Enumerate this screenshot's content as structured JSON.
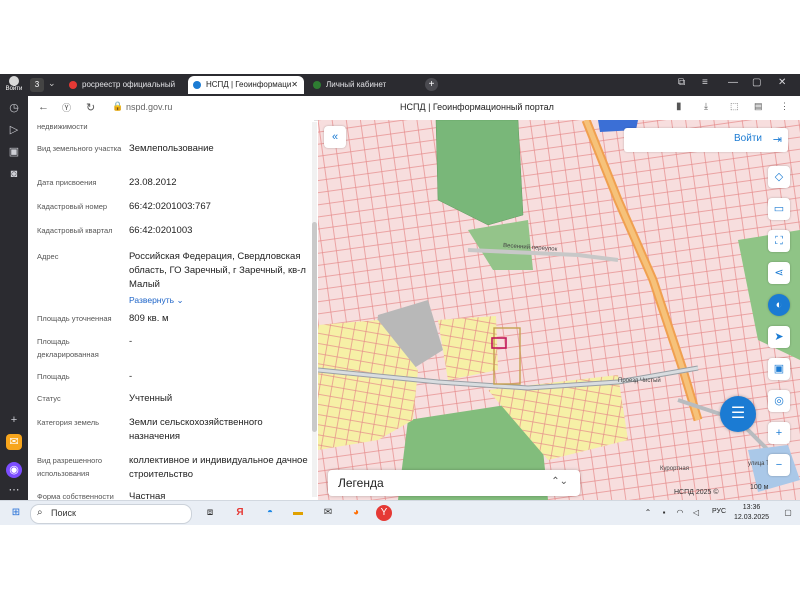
{
  "browser": {
    "tabs": [
      {
        "title": "росреестр официальный",
        "fav_color": "#e53935"
      },
      {
        "title": "НСПД | Геоинформаци",
        "fav_color": "#1b7bd3"
      },
      {
        "title": "Личный кабинет",
        "fav_color": "#2e7d32"
      }
    ],
    "url": "nspd.gov.ru",
    "page_title": "НСПД | Геоинформационный портал",
    "rail_login": "Войти"
  },
  "panel": {
    "top_fragment": "недвижимости",
    "fields": [
      {
        "label": "Вид земельного участка",
        "value": "Землепользование"
      },
      {
        "label": "Дата присвоения",
        "value": "23.08.2012"
      },
      {
        "label": "Кадастровый номер",
        "value": "66:42:0201003:767"
      },
      {
        "label": "Кадастровый квартал",
        "value": "66:42:0201003"
      },
      {
        "label": "Адрес",
        "value": "Российская Федерация, Свердловская область, ГО Заречный, г Заречный, кв-л Малый"
      },
      {
        "label": "Площадь уточненная",
        "value": "809 кв. м"
      },
      {
        "label": "Площадь декларированная",
        "value": "-"
      },
      {
        "label": "Площадь",
        "value": "-"
      },
      {
        "label": "Статус",
        "value": "Учтенный"
      },
      {
        "label": "Категория земель",
        "value": "Земли сельскохозяйственного назначения"
      },
      {
        "label": "Вид разрешенного использования",
        "value": "коллективное и индивидуальное дачное строительство"
      },
      {
        "label": "Форма собственности",
        "value": "Частная"
      }
    ],
    "expand_link": "Развернуть"
  },
  "map": {
    "login": "Войти",
    "legend": "Легенда",
    "copyright": "НСПД 2025 ©",
    "scale": "100 м",
    "street_labels": [
      "Весенний переулок",
      "Проезд Чистый",
      "улица Тага",
      "Курортная"
    ]
  },
  "taskbar": {
    "search": "Поиск",
    "lang": "РУС",
    "time": "13:36",
    "date": "12.03.2025"
  }
}
